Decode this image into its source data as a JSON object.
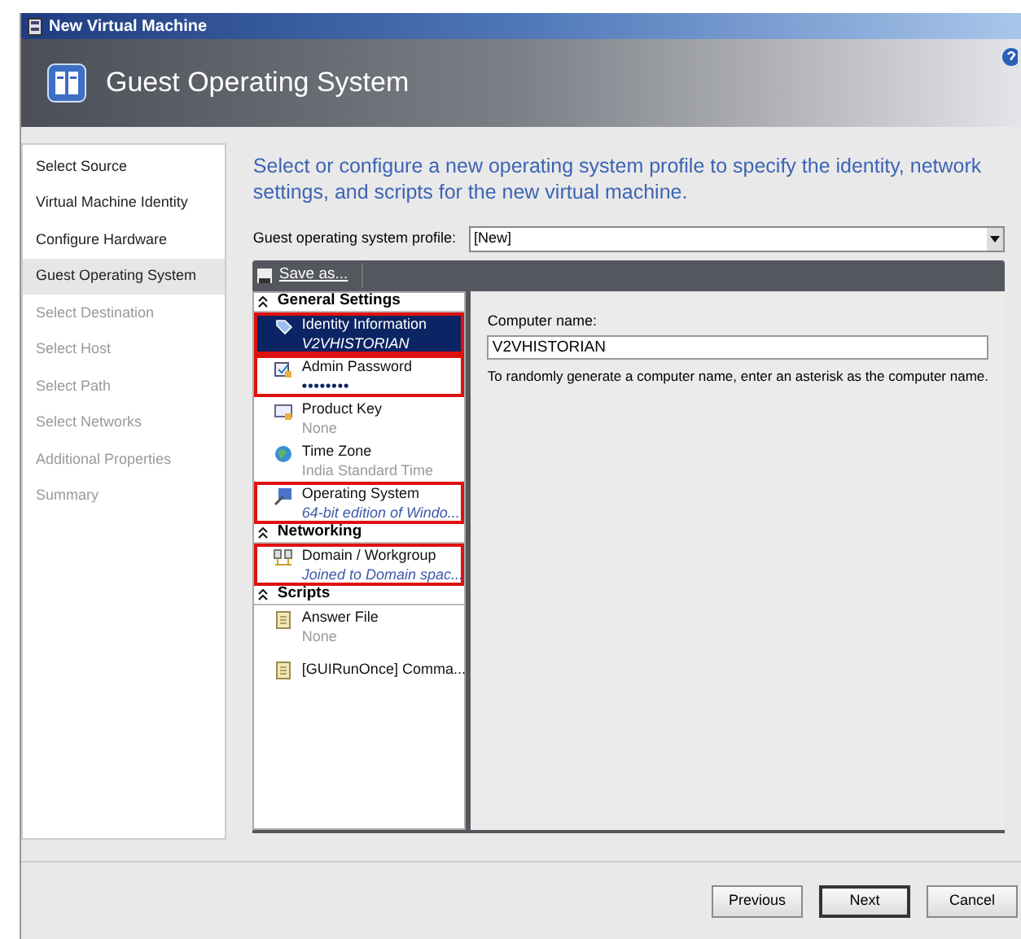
{
  "window": {
    "title": "New Virtual Machine"
  },
  "header": {
    "title": "Guest Operating System"
  },
  "nav": [
    {
      "label": "Select Source",
      "selected": false,
      "disabled": false
    },
    {
      "label": "Virtual Machine Identity",
      "selected": false,
      "disabled": false
    },
    {
      "label": "Configure Hardware",
      "selected": false,
      "disabled": false
    },
    {
      "label": "Guest Operating System",
      "selected": true,
      "disabled": false
    },
    {
      "label": "Select Destination",
      "selected": false,
      "disabled": true
    },
    {
      "label": "Select Host",
      "selected": false,
      "disabled": true
    },
    {
      "label": "Select Path",
      "selected": false,
      "disabled": true
    },
    {
      "label": "Select Networks",
      "selected": false,
      "disabled": true
    },
    {
      "label": "Additional Properties",
      "selected": false,
      "disabled": true
    },
    {
      "label": "Summary",
      "selected": false,
      "disabled": true
    }
  ],
  "intro": "Select or configure a new operating system profile to specify the identity, network settings, and scripts for the new virtual machine.",
  "profile": {
    "label": "Guest operating system profile:",
    "value": "[New]"
  },
  "toolbar": {
    "save_label": "Save as..."
  },
  "sections": [
    {
      "title": "General Settings",
      "expanded": true,
      "items": [
        {
          "label": "Identity Information",
          "value": "V2VHISTORIAN",
          "kind": "detail",
          "selected": true,
          "highlighted": true
        },
        {
          "label": "Admin Password",
          "value": "••••••••",
          "kind": "password",
          "selected": false,
          "highlighted": true
        },
        {
          "label": "Product Key",
          "value": "None",
          "kind": "muted",
          "selected": false,
          "highlighted": false
        },
        {
          "label": "Time Zone",
          "value": "India Standard Time",
          "kind": "muted",
          "selected": false,
          "highlighted": false
        },
        {
          "label": "Operating System",
          "value": "64-bit edition of Windo...",
          "kind": "detail",
          "selected": false,
          "highlighted": true
        }
      ]
    },
    {
      "title": "Networking",
      "expanded": true,
      "items": [
        {
          "label": "Domain / Workgroup",
          "value": "Joined to Domain spac...",
          "kind": "detail",
          "selected": false,
          "highlighted": true
        }
      ]
    },
    {
      "title": "Scripts",
      "expanded": true,
      "items": [
        {
          "label": "Answer File",
          "value": "None",
          "kind": "muted",
          "selected": false,
          "highlighted": false
        },
        {
          "label": "[GUIRunOnce] Comma...",
          "kind": "plain",
          "selected": false,
          "highlighted": false
        }
      ]
    }
  ],
  "detail": {
    "field_label": "Computer name:",
    "field_value": "V2VHISTORIAN",
    "hint": "To randomly generate a computer name, enter an asterisk as the computer name."
  },
  "buttons": [
    {
      "label": "Previous",
      "default": false
    },
    {
      "label": "Next",
      "default": true
    },
    {
      "label": "Cancel",
      "default": false
    }
  ]
}
